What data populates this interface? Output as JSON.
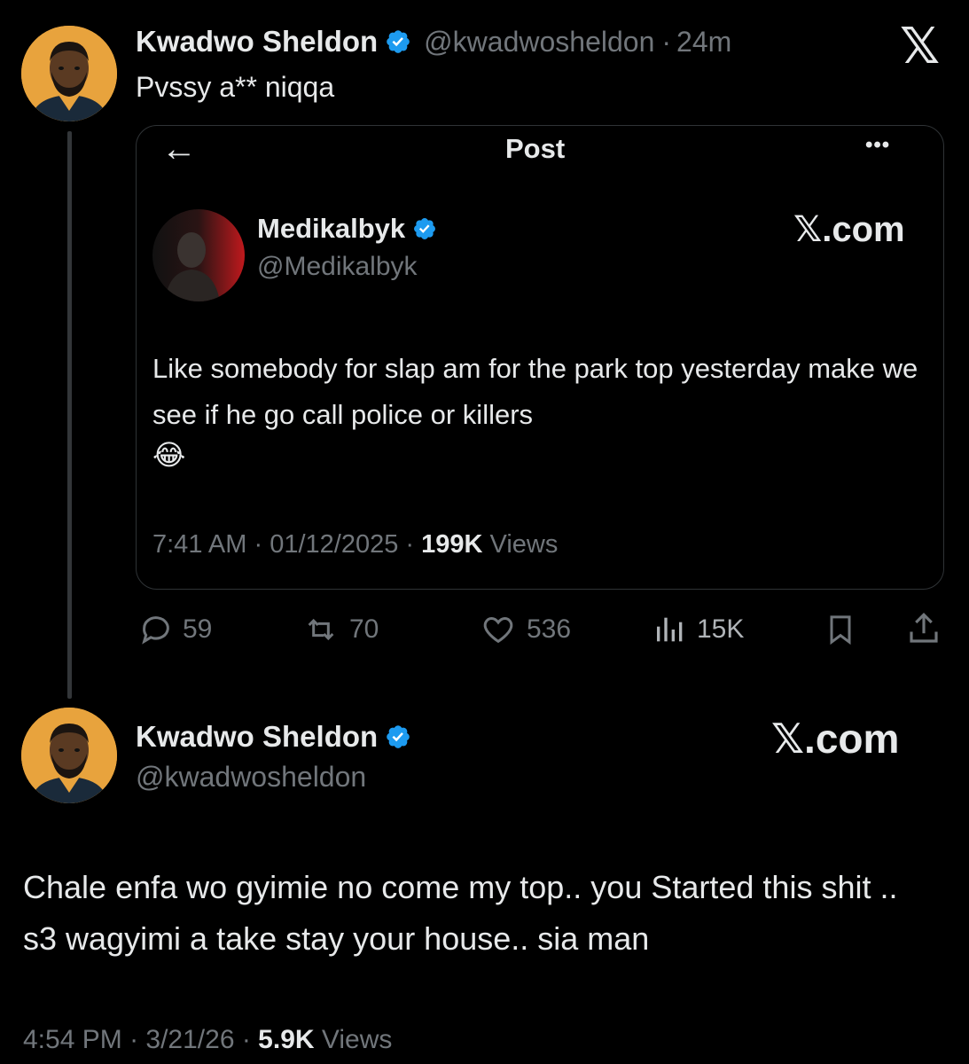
{
  "tweet1": {
    "author_name": "Kwadwo Sheldon",
    "handle": "@kwadwosheldon",
    "separator": "·",
    "age": "24m",
    "text": "Pvssy a** niqqa",
    "platform_logo": "𝕏"
  },
  "quoted": {
    "header_title": "Post",
    "back_icon": "←",
    "more_icon": "•••",
    "author_name": "Medikalbyk",
    "handle": "@Medikalbyk",
    "site": "𝕏.com",
    "text": "Like somebody for slap am for the park top yesterday make we see if he go call police or killers",
    "emoji": "😂",
    "time": "7:41 AM",
    "date": "01/12/2025",
    "views_count": "199K",
    "views_label": "Views"
  },
  "actions": {
    "replies": "59",
    "reposts": "70",
    "likes": "536",
    "views": "15K"
  },
  "tweet2": {
    "author_name": "Kwadwo Sheldon",
    "handle": "@kwadwosheldon",
    "site": "𝕏.com",
    "text": "Chale enfa wo gyimie no come my top.. you Started this shit .. s3 wagyimi a take stay your house.. sia man",
    "time": "4:54 PM",
    "date": "3/21/26",
    "views_count": "5.9K",
    "views_label": "Views"
  },
  "colors": {
    "background": "#000000",
    "text": "#e7e9ea",
    "muted": "#71767b",
    "verified": "#1d9bf0",
    "avatar_bg": "#e8a33d"
  }
}
